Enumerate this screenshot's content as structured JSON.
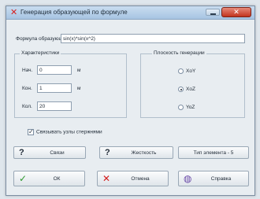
{
  "window": {
    "title": "Генерация образующей по формуле",
    "close_symbol": "✕"
  },
  "formula": {
    "label": "Формула образующей:",
    "value": "sin(x)*sin(x^2)"
  },
  "characteristics": {
    "title": "Характеристики",
    "rows": [
      {
        "label": "Нач.",
        "value": "0",
        "unit": "м"
      },
      {
        "label": "Кон.",
        "value": "1",
        "unit": "м"
      },
      {
        "label": "Кол.",
        "value": "20",
        "unit": ""
      }
    ]
  },
  "plane": {
    "title": "Плоскость генерации",
    "options": [
      {
        "label": "XoY",
        "selected": false
      },
      {
        "label": "XoZ",
        "selected": true
      },
      {
        "label": "YoZ",
        "selected": false
      }
    ]
  },
  "link_nodes": {
    "label": "Связывать узлы стержнями",
    "checked": true,
    "check_symbol": "✓"
  },
  "buttons": {
    "links": {
      "label": "Связи",
      "icon": "?"
    },
    "stiffness": {
      "label": "Жесткость",
      "icon": "?"
    },
    "element_type": {
      "label": "Тип элемента - 5"
    },
    "ok": {
      "label": "ОК",
      "icon": "✓"
    },
    "cancel": {
      "label": "Отмена",
      "icon": "✕"
    },
    "help": {
      "label": "Справка",
      "icon": "◍"
    }
  },
  "colors": {
    "ok_icon": "#2e9a2e",
    "cancel_icon": "#d31c1c",
    "help_icon": "#6a4aa8",
    "question_icon": "#1f2a36"
  }
}
